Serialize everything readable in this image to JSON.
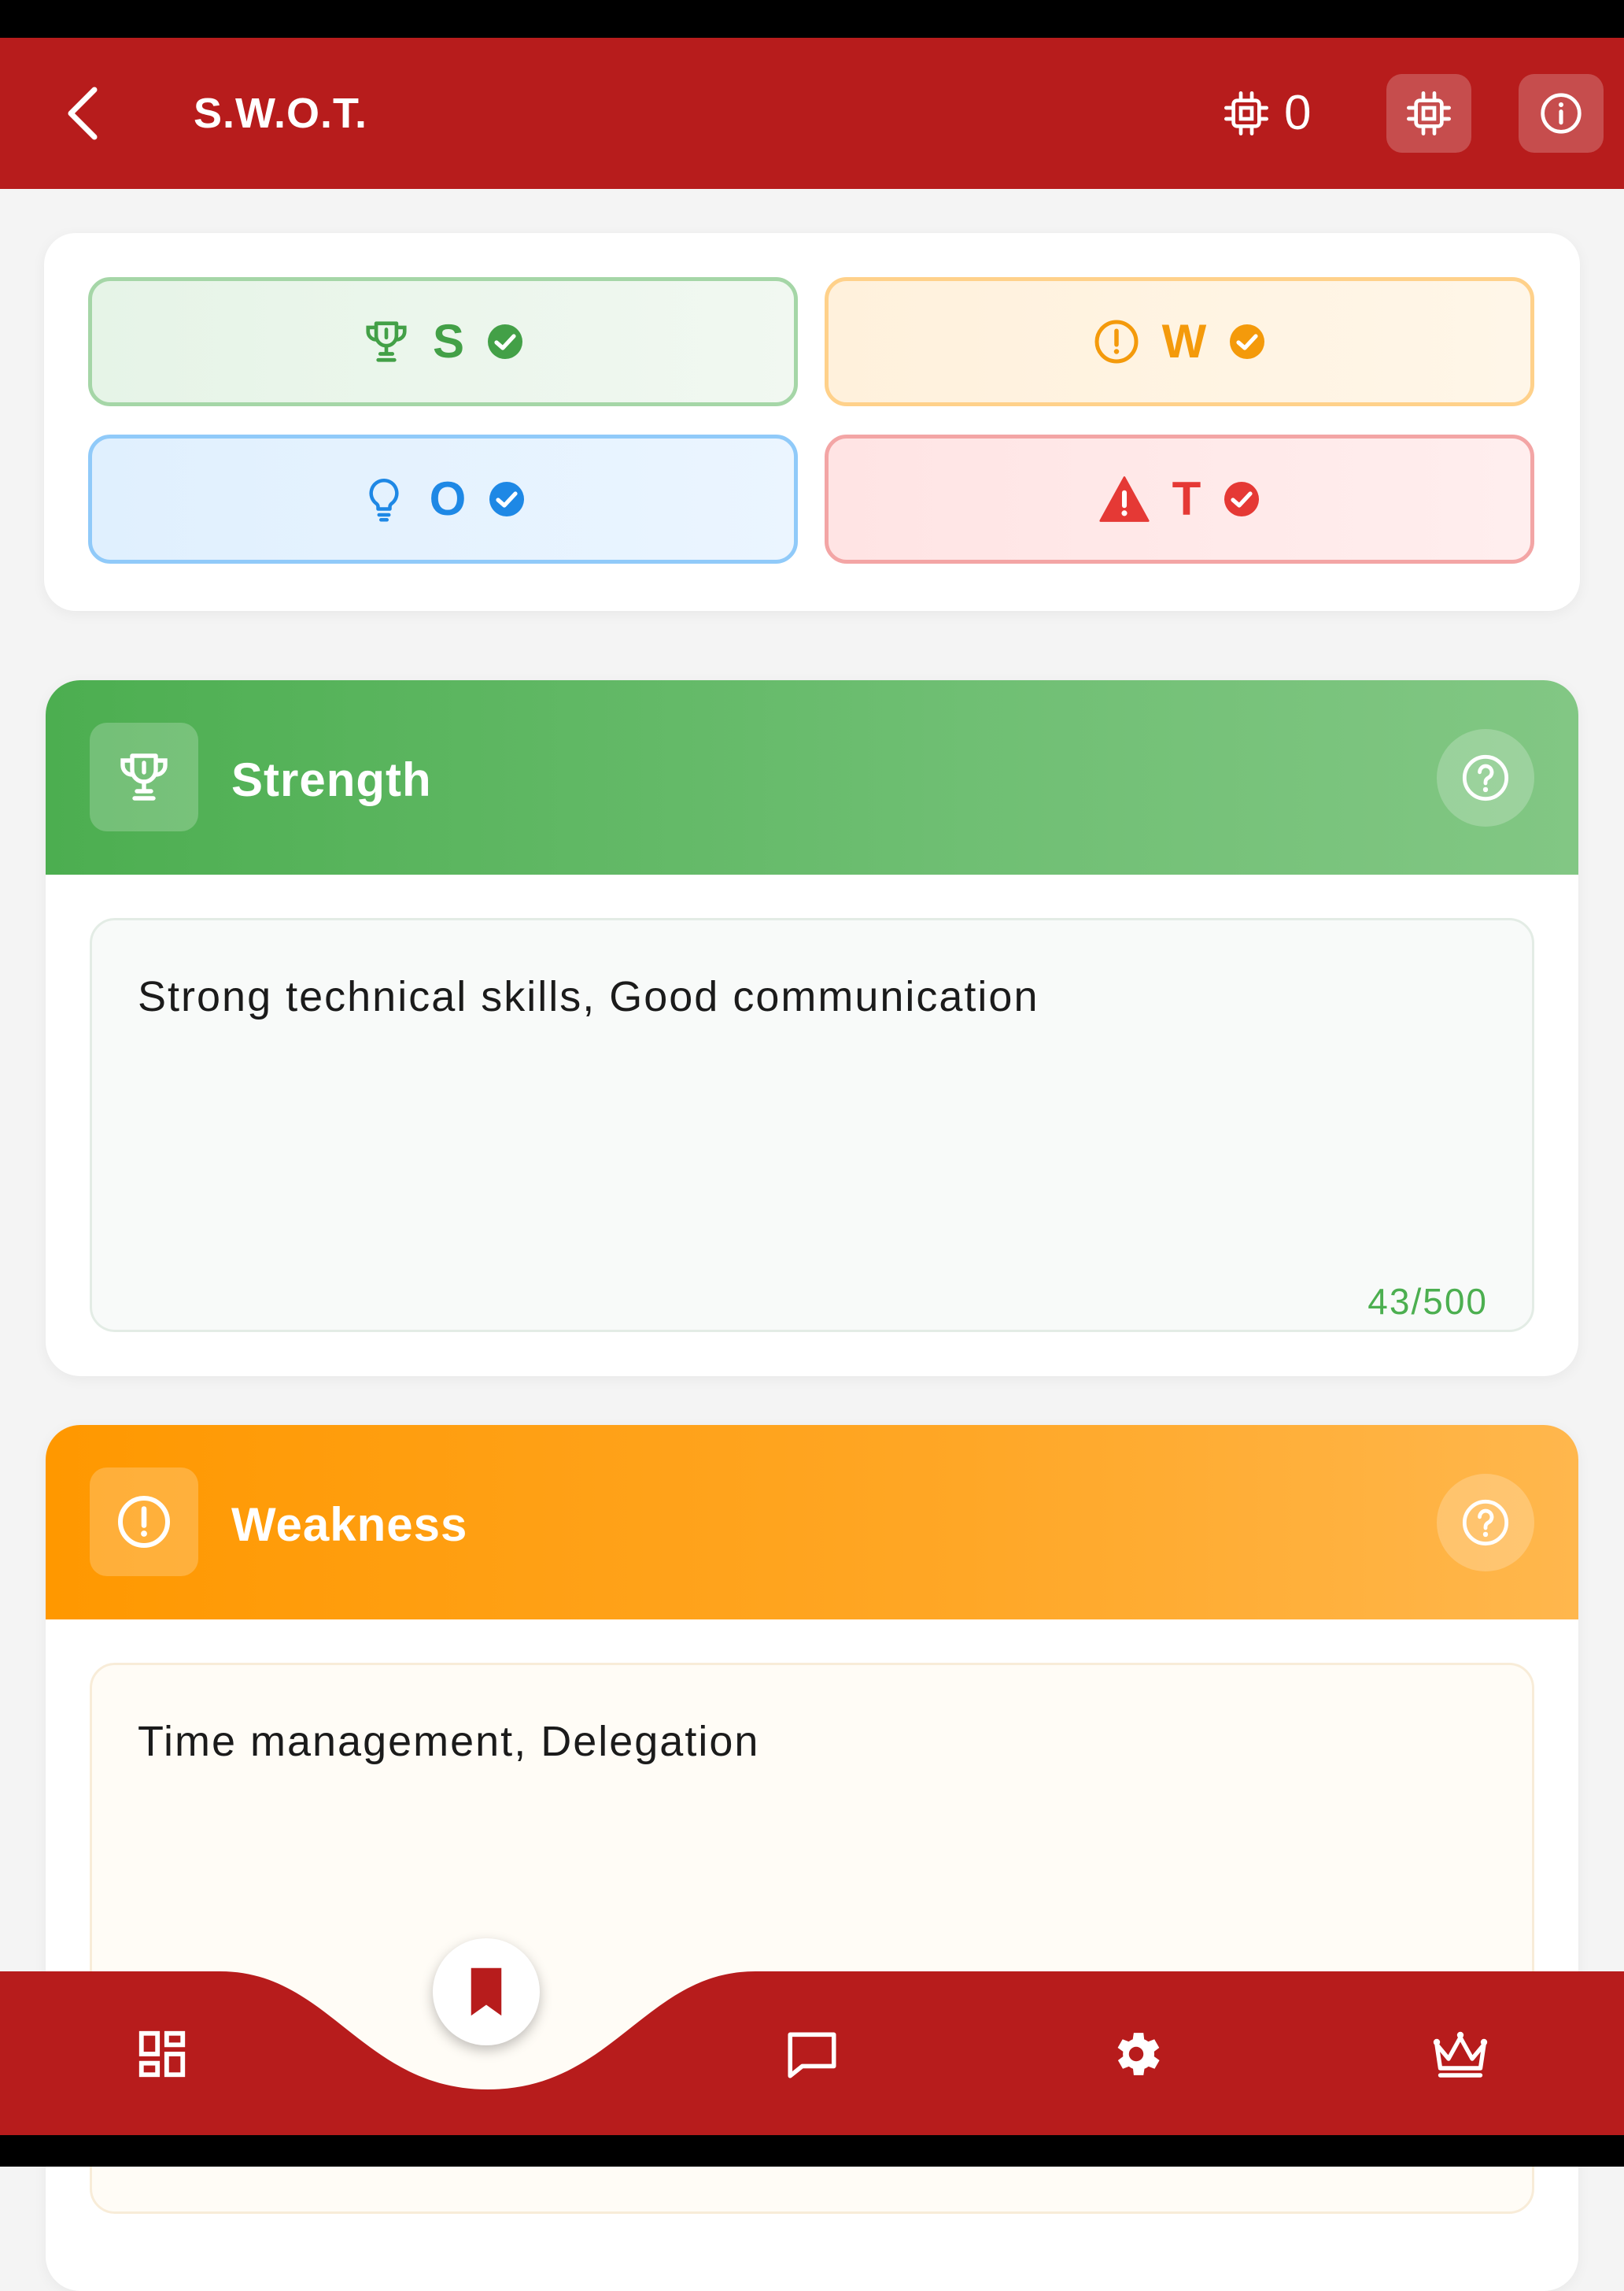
{
  "app_bar": {
    "title": "S.W.O.T.",
    "credits_count": "0",
    "icons": [
      "back-arrow-icon",
      "chip-icon",
      "chip-icon",
      "info-icon"
    ]
  },
  "summary": {
    "chips": [
      {
        "letter": "S",
        "icon": "trophy-icon",
        "status": "check-circle-icon",
        "color": "#43a047"
      },
      {
        "letter": "W",
        "icon": "alert-circle-icon",
        "status": "check-circle-icon",
        "color": "#f49a0b"
      },
      {
        "letter": "O",
        "icon": "lightbulb-icon",
        "status": "check-circle-icon",
        "color": "#1e88e5"
      },
      {
        "letter": "T",
        "icon": "warning-triangle-icon",
        "status": "check-circle-icon",
        "color": "#e53935"
      }
    ]
  },
  "sections": {
    "strength": {
      "title": "Strength",
      "text": "Strong technical skills, Good communication",
      "char_count": "43/500",
      "accent": "#4caf50"
    },
    "weakness": {
      "title": "Weakness",
      "text": "Time management, Delegation",
      "accent": "#ff9800"
    }
  },
  "bottom_nav": {
    "items": [
      "dashboard-icon",
      "bookmark-icon",
      "chat-icon",
      "settings-icon",
      "crown-icon"
    ],
    "active": "bookmark-icon",
    "bar_color": "#b71c1c"
  }
}
